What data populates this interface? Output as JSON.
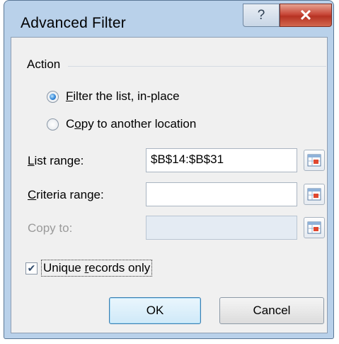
{
  "window": {
    "title": "Advanced Filter",
    "help_glyph": "?",
    "close_glyph": "✕"
  },
  "action": {
    "group_label": "Action",
    "options": [
      {
        "label_pre": "",
        "label_ul": "F",
        "label_post": "ilter the list, in-place",
        "selected": true
      },
      {
        "label_pre": "C",
        "label_ul": "o",
        "label_post": "py to another location",
        "selected": false
      }
    ]
  },
  "fields": {
    "list_range": {
      "label_ul": "L",
      "label_rest": "ist range:",
      "value": "$B$14:$B$31"
    },
    "criteria_range": {
      "label_ul": "C",
      "label_rest": "riteria range:",
      "value": ""
    },
    "copy_to": {
      "label": "Copy to:",
      "value": "",
      "disabled": true
    }
  },
  "unique": {
    "label_pre": "Unique ",
    "label_ul": "r",
    "label_post": "ecords only",
    "checked": true
  },
  "buttons": {
    "ok": "OK",
    "cancel": "Cancel"
  },
  "icons": {
    "ref_button_icon": "range-select-icon"
  }
}
